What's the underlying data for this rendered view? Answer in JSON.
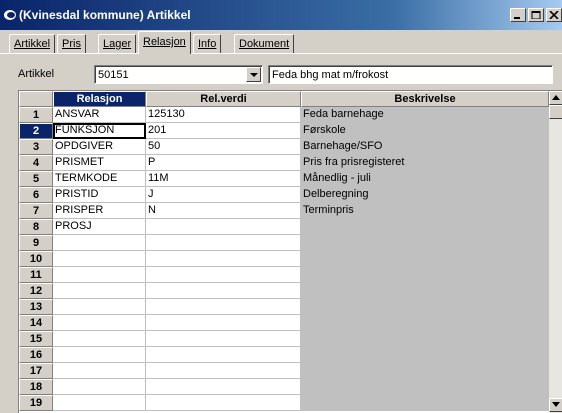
{
  "window": {
    "title": "(Kvinesdal kommune) Artikkel",
    "icon": "app-logo-icon",
    "controls": [
      "minimize-icon",
      "restore-icon",
      "close-icon"
    ]
  },
  "tabs": [
    {
      "label": "Artikkel",
      "active": false
    },
    {
      "label": "Pris",
      "active": false
    },
    {
      "label": "Lager",
      "active": false
    },
    {
      "label": "Relasjon",
      "active": true
    },
    {
      "label": "Info",
      "active": false
    },
    {
      "label": "Dokument",
      "active": false
    }
  ],
  "form": {
    "artikkel_label": "Artikkel",
    "artikkel_value": "50151",
    "description_value": "Feda bhg mat m/frokost"
  },
  "grid": {
    "columns": [
      "Relasjon",
      "Rel.verdi",
      "Beskrivelse"
    ],
    "selected_column": 0,
    "selected_row": 2,
    "rows": [
      {
        "num": "1",
        "relasjon": "ANSVAR",
        "verdi": "125130",
        "beskrivelse": "Feda barnehage"
      },
      {
        "num": "2",
        "relasjon": "FUNKSJON",
        "verdi": "201",
        "beskrivelse": "Førskole"
      },
      {
        "num": "3",
        "relasjon": "OPDGIVER",
        "verdi": "50",
        "beskrivelse": "Barnehage/SFO"
      },
      {
        "num": "4",
        "relasjon": "PRISMET",
        "verdi": "P",
        "beskrivelse": "Pris fra prisregisteret"
      },
      {
        "num": "5",
        "relasjon": "TERMKODE",
        "verdi": "11M",
        "beskrivelse": "Månedlig - juli"
      },
      {
        "num": "6",
        "relasjon": "PRISTID",
        "verdi": "J",
        "beskrivelse": "Delberegning"
      },
      {
        "num": "7",
        "relasjon": "PRISPER",
        "verdi": "N",
        "beskrivelse": "Terminpris"
      },
      {
        "num": "8",
        "relasjon": "PROSJ",
        "verdi": "",
        "beskrivelse": ""
      },
      {
        "num": "9",
        "relasjon": "",
        "verdi": "",
        "beskrivelse": ""
      },
      {
        "num": "10",
        "relasjon": "",
        "verdi": "",
        "beskrivelse": ""
      },
      {
        "num": "11",
        "relasjon": "",
        "verdi": "",
        "beskrivelse": ""
      },
      {
        "num": "12",
        "relasjon": "",
        "verdi": "",
        "beskrivelse": ""
      },
      {
        "num": "13",
        "relasjon": "",
        "verdi": "",
        "beskrivelse": ""
      },
      {
        "num": "14",
        "relasjon": "",
        "verdi": "",
        "beskrivelse": ""
      },
      {
        "num": "15",
        "relasjon": "",
        "verdi": "",
        "beskrivelse": ""
      },
      {
        "num": "16",
        "relasjon": "",
        "verdi": "",
        "beskrivelse": ""
      },
      {
        "num": "17",
        "relasjon": "",
        "verdi": "",
        "beskrivelse": ""
      },
      {
        "num": "18",
        "relasjon": "",
        "verdi": "",
        "beskrivelse": ""
      },
      {
        "num": "19",
        "relasjon": "",
        "verdi": "",
        "beskrivelse": ""
      }
    ]
  }
}
